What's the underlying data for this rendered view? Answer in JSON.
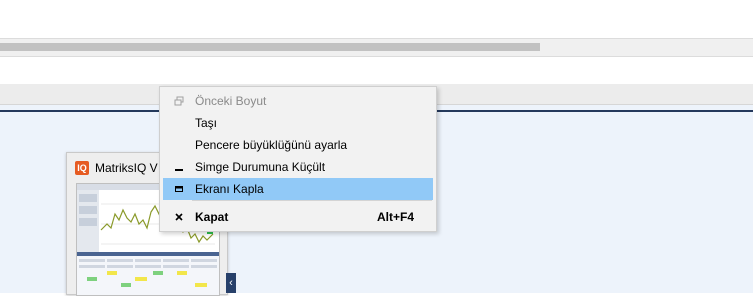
{
  "colors": {
    "menu_background": "#f2f2f2",
    "menu_highlight": "#91c9f7",
    "panel_rule": "#24395c",
    "app_logo": "#e65b22"
  },
  "taskbar_thumbnail": {
    "logo_text": "IQ",
    "title": "MatriksIQ V",
    "side_button_glyph": "‹"
  },
  "context_menu": {
    "items": [
      {
        "label": "Önceki Boyut",
        "icon": "restore-icon",
        "disabled": true
      },
      {
        "label": "Taşı",
        "icon": "",
        "disabled": false
      },
      {
        "label": "Pencere büyüklüğünü ayarla",
        "icon": "",
        "disabled": false
      },
      {
        "label": "Simge Durumuna Küçült",
        "icon": "minimize-icon",
        "disabled": false
      },
      {
        "label": "Ekranı Kapla",
        "icon": "maximize-icon",
        "disabled": false,
        "highlighted": true
      },
      {
        "label": "Kapat",
        "icon": "close-icon",
        "shortcut": "Alt+F4",
        "bold": true
      }
    ]
  }
}
